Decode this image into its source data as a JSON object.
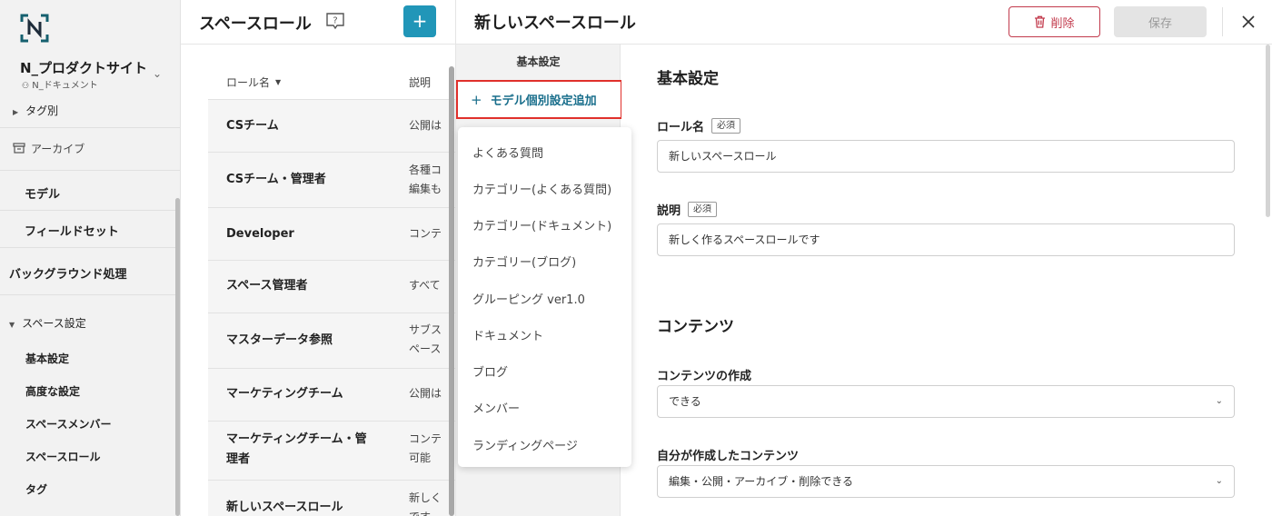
{
  "sidebar": {
    "org_name": "N_プロダクトサイト",
    "org_sub": "N_ドキュメント",
    "items": [
      {
        "label": "タグ別"
      },
      {
        "label": "アーカイブ"
      },
      {
        "label": "モデル"
      },
      {
        "label": "フィールドセット"
      },
      {
        "label": "バックグラウンド処理"
      },
      {
        "label": "スペース設定"
      },
      {
        "label": "基本設定"
      },
      {
        "label": "高度な設定"
      },
      {
        "label": "スペースメンバー"
      },
      {
        "label": "スペースロール"
      },
      {
        "label": "タグ"
      }
    ]
  },
  "list": {
    "title": "スペースロール",
    "add_label": "+",
    "columns": {
      "name": "ロール名",
      "desc": "説明"
    },
    "rows": [
      {
        "name": "CSチーム",
        "desc": "公開は"
      },
      {
        "name": "CSチーム・管理者",
        "desc1": "各種コ",
        "desc2": "編集も"
      },
      {
        "name": "Developer",
        "desc": "コンテ"
      },
      {
        "name": "スペース管理者",
        "desc": "すべて"
      },
      {
        "name": "マスターデータ参照",
        "desc1": "サブス",
        "desc2": "ペース"
      },
      {
        "name": "マーケティングチーム",
        "desc": "公開は"
      },
      {
        "name1": "マーケティングチーム・管",
        "name2": "理者",
        "desc1": "コンテ",
        "desc2": "可能"
      },
      {
        "name": "新しいスペースロール",
        "desc1": "新しく",
        "desc2": "です"
      }
    ]
  },
  "detail": {
    "title": "新しいスペースロール",
    "delete_label": "削除",
    "save_label": "保存",
    "tab_basic": "基本設定",
    "add_model_label": "モデル個別設定追加",
    "add_model_plus": "+",
    "dropdown": [
      "よくある質問",
      "カテゴリー(よくある質問)",
      "カテゴリー(ドキュメント)",
      "カテゴリー(ブログ)",
      "グルーピング ver1.0",
      "ドキュメント",
      "ブログ",
      "メンバー",
      "ランディングページ"
    ],
    "form": {
      "section_basic": "基本設定",
      "role_name_label": "ロール名",
      "required": "必須",
      "role_name_value": "新しいスペースロール",
      "desc_label": "説明",
      "desc_value": "新しく作るスペースロールです",
      "section_contents": "コンテンツ",
      "create_label": "コンテンツの作成",
      "create_value": "できる",
      "own_label": "自分が作成したコンテンツ",
      "own_value": "編集・公開・アーカイブ・削除できる"
    }
  },
  "colors": {
    "accent": "#2196b8",
    "danger": "#c23a4c",
    "highlight": "#e0302b",
    "link": "#1a6f8c"
  }
}
